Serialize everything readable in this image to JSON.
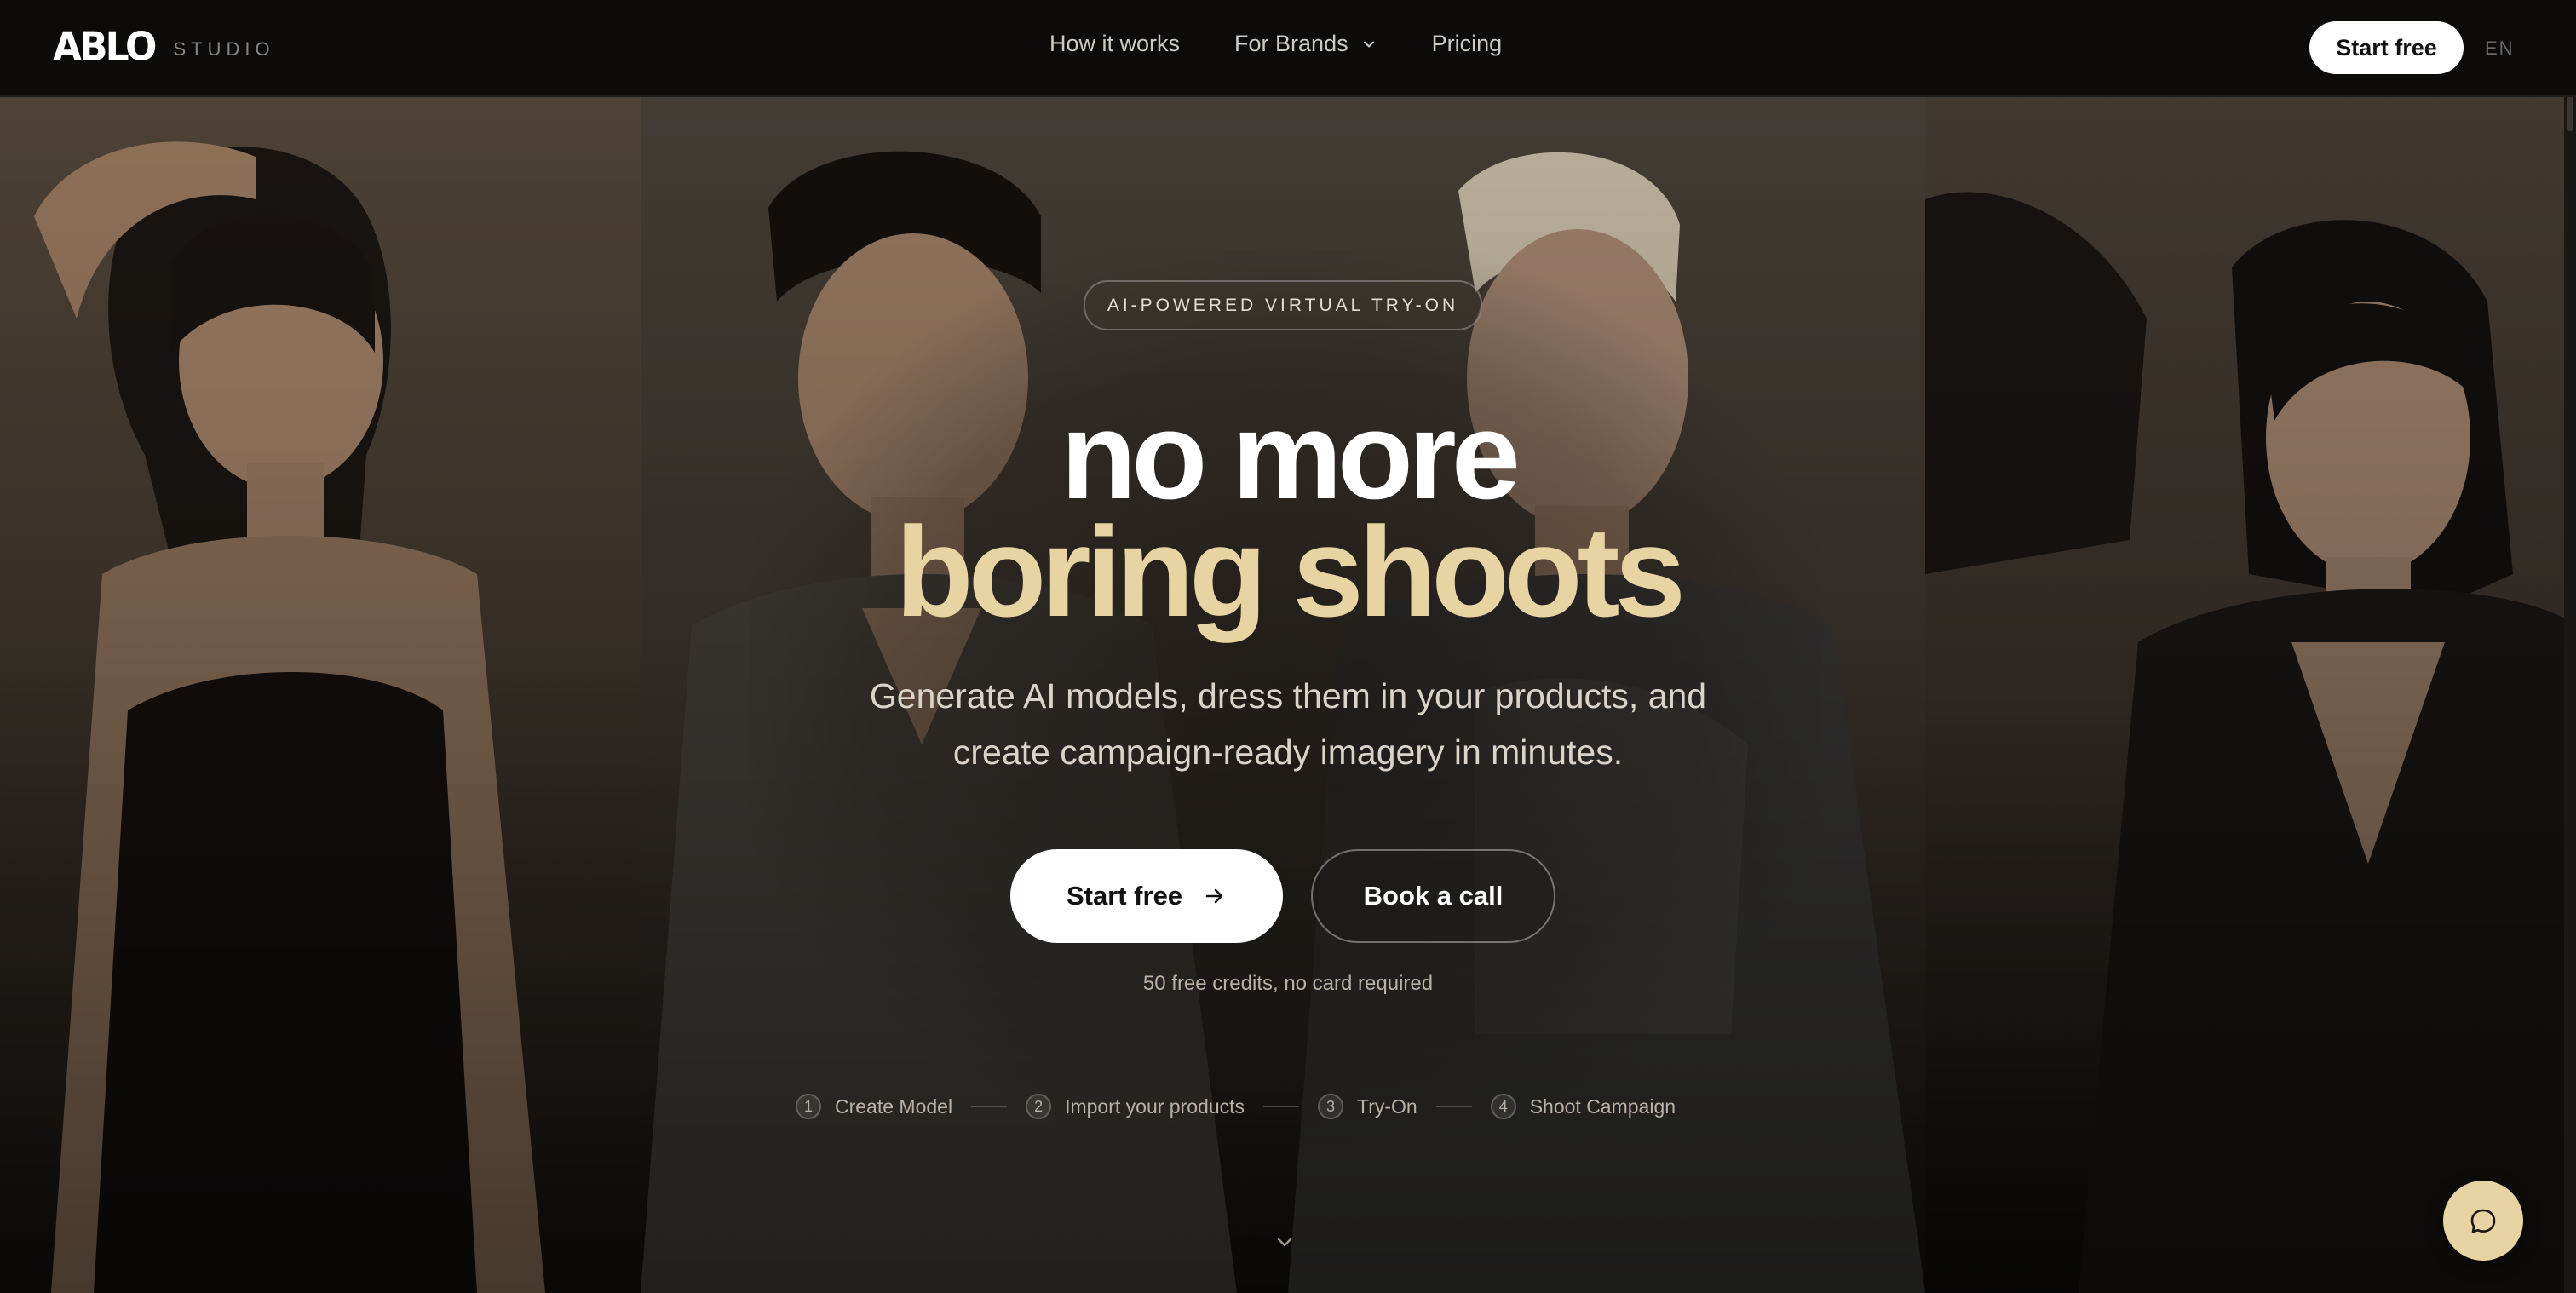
{
  "header": {
    "logo_mark": "ABLO",
    "logo_sub": "STUDIO",
    "nav": [
      "How it works",
      "For Brands",
      "Pricing"
    ],
    "cta": "Start free",
    "language": "EN"
  },
  "hero": {
    "badge": "AI-POWERED VIRTUAL TRY-ON",
    "headline_line1": "no more",
    "headline_line2": "boring shoots",
    "subtitle_line1": "Generate AI models, dress them in your products, and",
    "subtitle_line2": "create campaign-ready imagery in minutes.",
    "primary_cta": "Start free",
    "secondary_cta": "Book a call",
    "note": "50 free credits, no card required",
    "steps": [
      {
        "num": "1",
        "label": "Create Model"
      },
      {
        "num": "2",
        "label": "Import your products"
      },
      {
        "num": "3",
        "label": "Try-On"
      },
      {
        "num": "4",
        "label": "Shoot Campaign"
      }
    ]
  },
  "icons": {
    "nav_dropdown": "chevron-down-icon",
    "primary_cta": "arrow-right-icon",
    "scroll": "chevron-down-icon",
    "chat": "chat-bubble-icon"
  },
  "colors": {
    "accent": "#e8d4a2",
    "background": "#0b0a09",
    "headline_primary": "#ffffff"
  }
}
